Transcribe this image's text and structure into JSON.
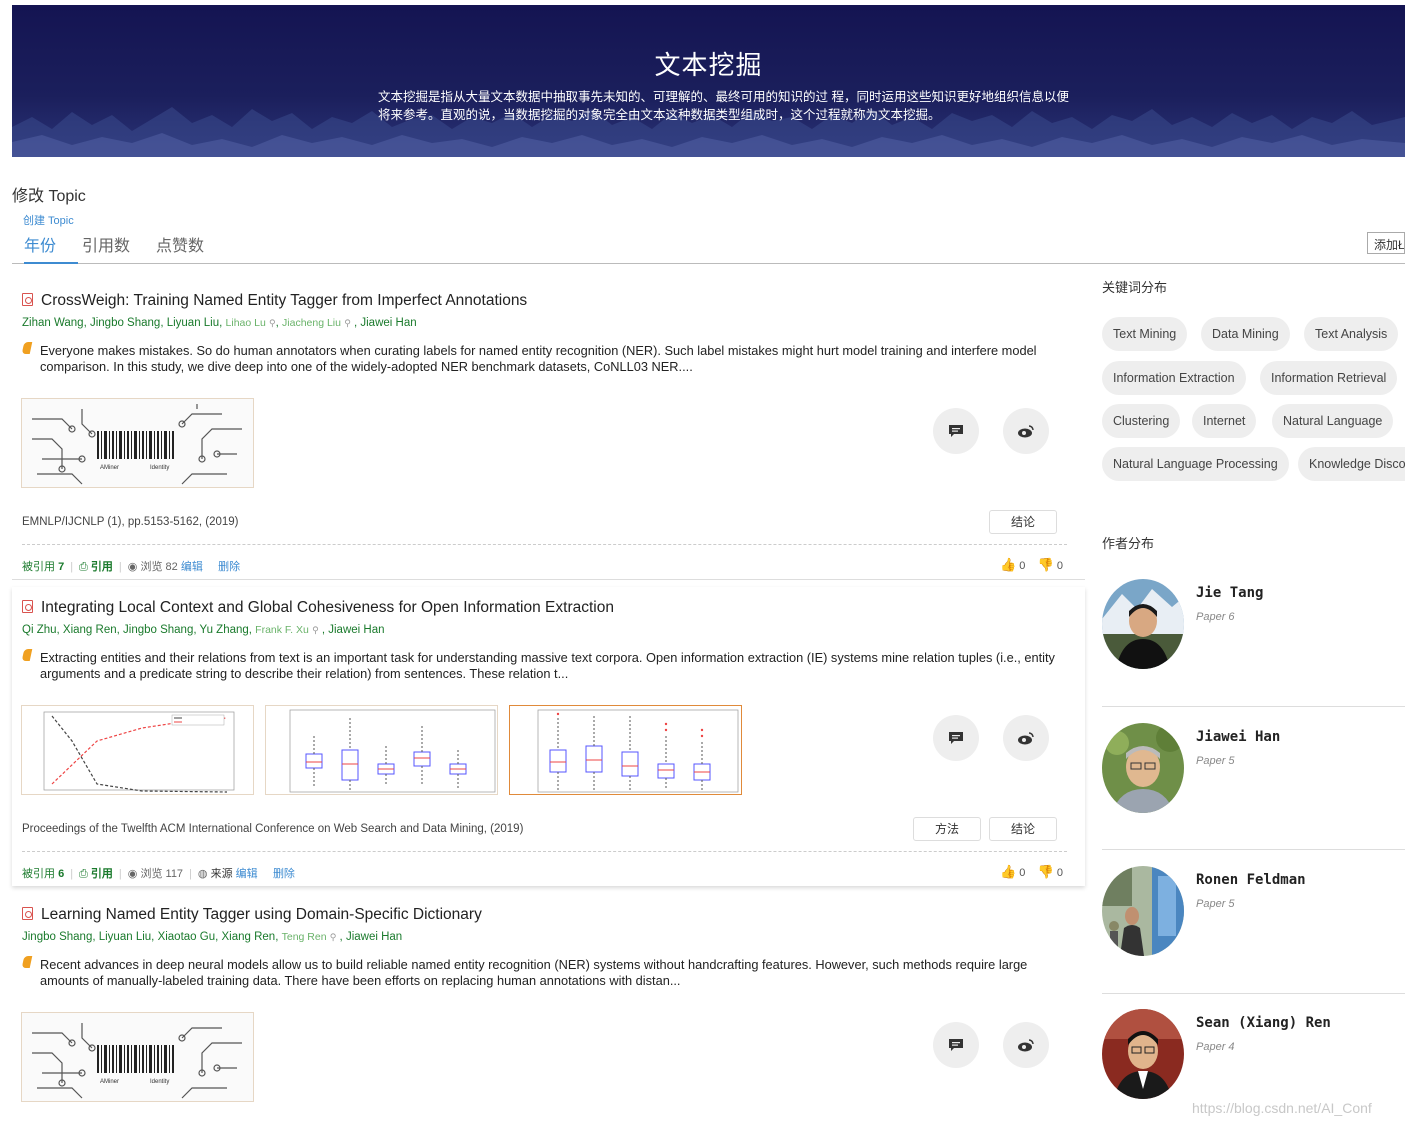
{
  "banner": {
    "title": "文本挖掘",
    "description": "文本挖掘是指从大量文本数据中抽取事先未知的、可理解的、最终可用的知识的过 程，同时运用这些知识更好地组织信息以便将来参考。直观的说，当数据挖掘的对象完全由文本这种数据类型组成时，这个过程就称为文本挖掘。"
  },
  "topic": {
    "title": "修改 Topic",
    "create": "创建 Topic"
  },
  "tabs": [
    "年份",
    "引用数",
    "点赞数"
  ],
  "add_button": "添加Ł",
  "papers": [
    {
      "title": "CrossWeigh: Training Named Entity Tagger from Imperfect Annotations",
      "authors": [
        "Zihan Wang",
        "Jingbo Shang",
        "Liyuan Liu",
        "Lihao Lu",
        "Jiacheng Liu",
        "Jiawei Han"
      ],
      "abstract": "Everyone makes mistakes. So do human annotators when curating labels for named entity recognition (NER). Such label mistakes might hurt model training and interfere model comparison. In this study, we dive deep into one of the widely-adopted NER benchmark datasets, CoNLL03 NER....",
      "venue": "EMNLP/IJCNLP (1), pp.5153-5162, (2019)",
      "tags": [
        "结论"
      ],
      "cited_label": "被引用",
      "cited": "7",
      "cite": "引用",
      "views_label": "浏览",
      "views": "82",
      "edit": "编辑",
      "delete": "删除",
      "likes": "0",
      "dislikes": "0"
    },
    {
      "title": "Integrating Local Context and Global Cohesiveness for Open Information Extraction",
      "authors": [
        "Qi Zhu",
        "Xiang Ren",
        "Jingbo Shang",
        "Yu Zhang",
        "Frank F. Xu",
        "Jiawei Han"
      ],
      "abstract": "Extracting entities and their relations from text is an important task for understanding massive text corpora. Open information extraction (IE) systems mine relation tuples (i.e., entity arguments and a predicate string to describe their relation) from sentences. These relation t...",
      "venue": "Proceedings of the Twelfth ACM International Conference on Web Search and Data Mining, (2019)",
      "tags": [
        "方法",
        "结论"
      ],
      "cited_label": "被引用",
      "cited": "6",
      "cite": "引用",
      "views_label": "浏览",
      "views": "117",
      "source": "来源",
      "edit": "编辑",
      "delete": "删除",
      "likes": "0",
      "dislikes": "0"
    },
    {
      "title": "Learning Named Entity Tagger using Domain-Specific Dictionary",
      "authors": [
        "Jingbo Shang",
        "Liyuan Liu",
        "Xiaotao Gu",
        "Xiang Ren",
        "Teng Ren",
        "Jiawei Han"
      ],
      "abstract": "Recent advances in deep neural models allow us to build reliable named entity recognition (NER) systems without handcrafting features. However, such methods require large amounts of manually-labeled training data. There have been efforts on replacing human annotations with distan..."
    }
  ],
  "placeholder_logo": {
    "left": "AMiner",
    "right": "Identity"
  },
  "sidebar": {
    "keywords_heading": "关键词分布",
    "keywords": [
      "Text Mining",
      "Data Mining",
      "Text Analysis",
      "Information Extraction",
      "Information Retrieval",
      "Clustering",
      "Internet",
      "Natural Language",
      "Natural Language Processing",
      "Knowledge Disco"
    ],
    "authors_heading": "作者分布",
    "authors": [
      {
        "name": "Jie Tang",
        "papers": "Paper 6"
      },
      {
        "name": "Jiawei Han",
        "papers": "Paper 5"
      },
      {
        "name": "Ronen Feldman",
        "papers": "Paper 5"
      },
      {
        "name": "Sean (Xiang) Ren",
        "papers": "Paper 4"
      }
    ]
  },
  "watermark": "https://blog.csdn.net/AI_Conf",
  "colors": {
    "accent": "#3d8bd1",
    "author_green": "#1a7a2c",
    "banner": "#141452"
  }
}
